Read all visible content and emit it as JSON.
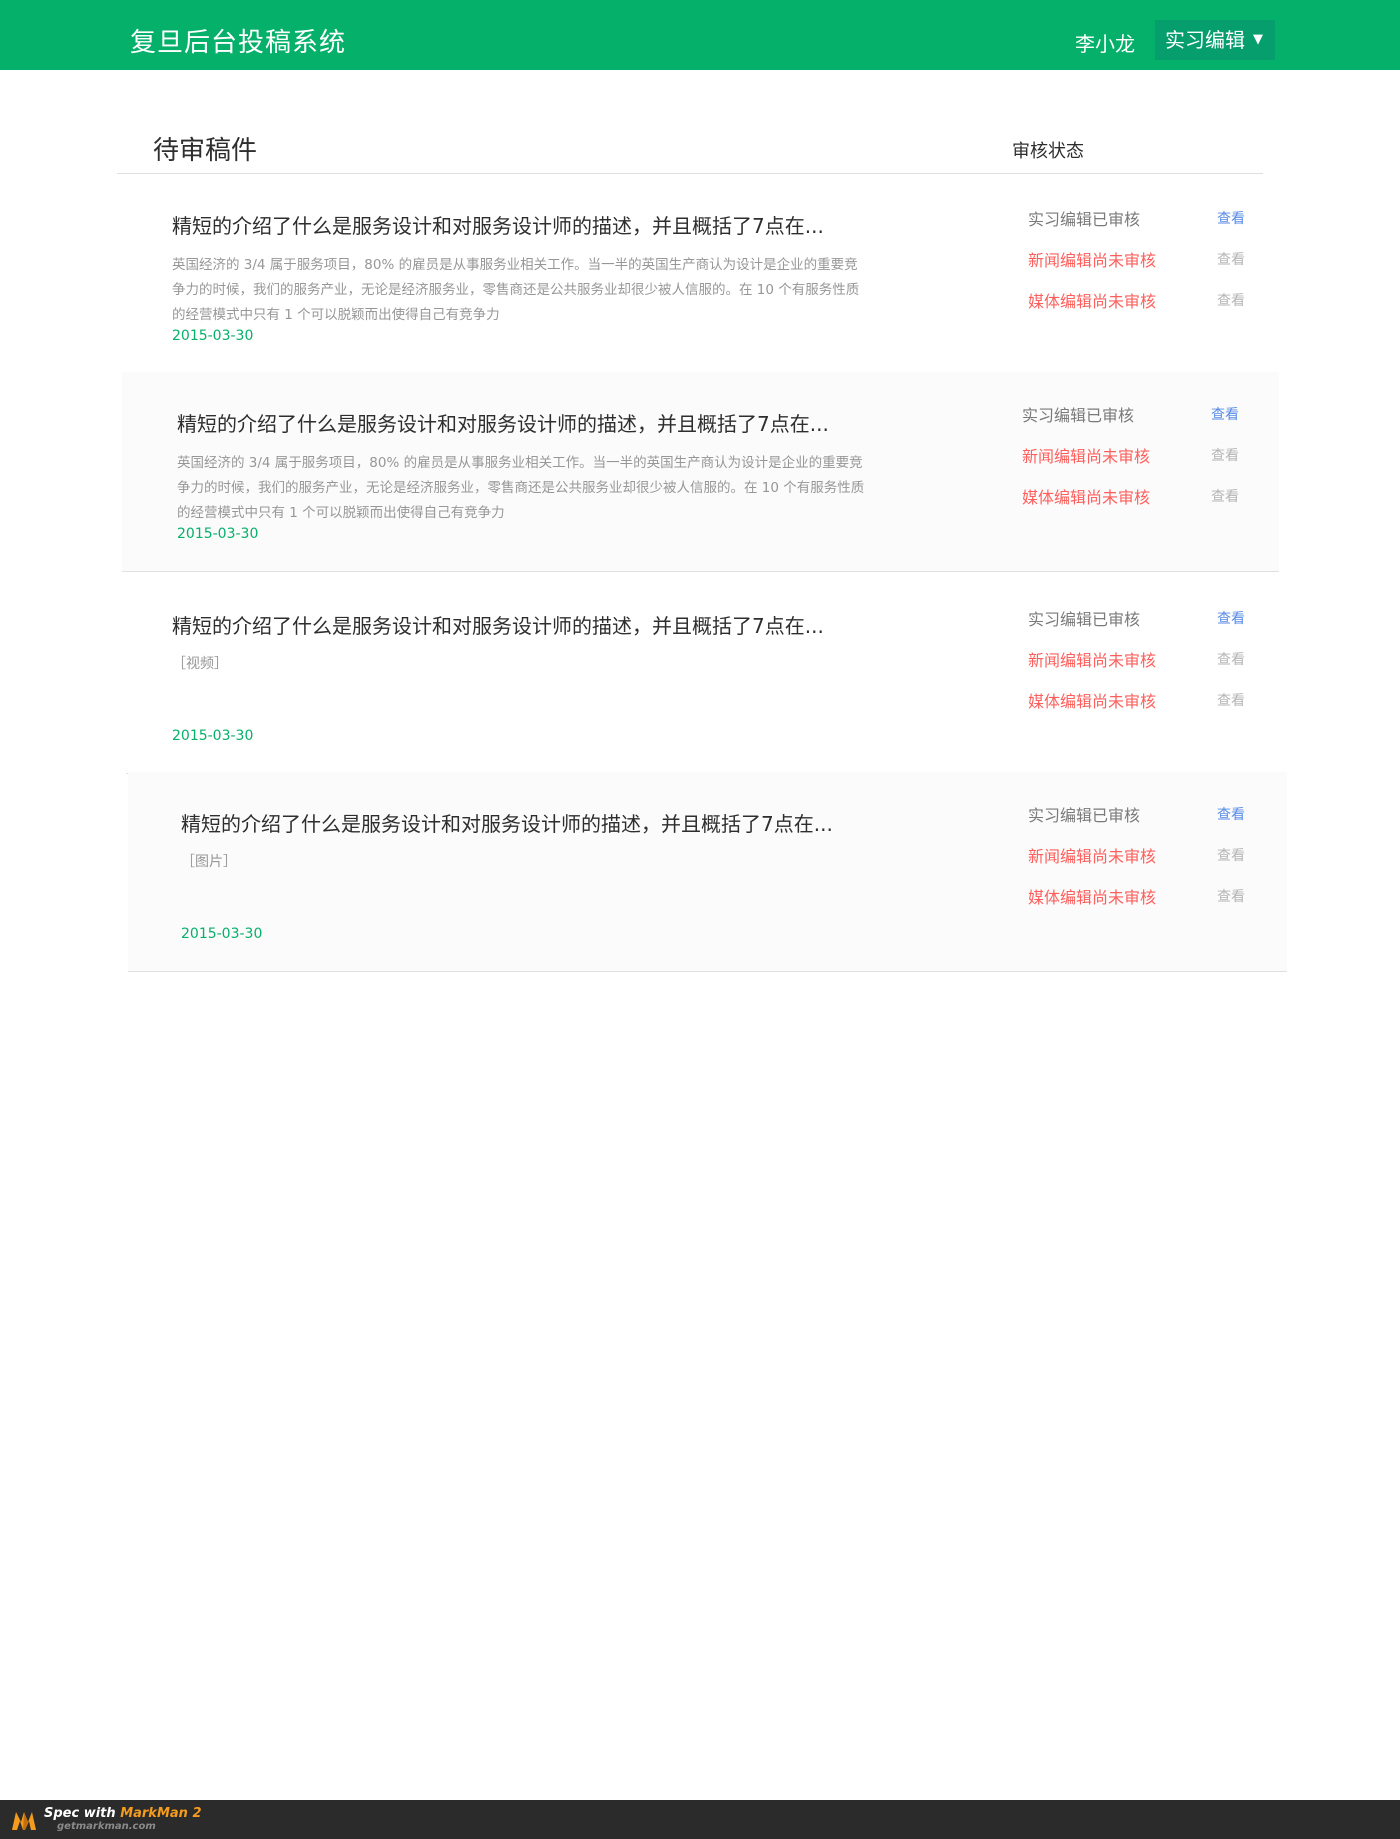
{
  "header": {
    "app_title": "复旦后台投稿系统",
    "user_name": "李小龙",
    "role_label": "实习编辑",
    "role_arrow": "▼"
  },
  "main": {
    "section_title": "待审稿件",
    "status_column_title": "审核状态"
  },
  "articles": [
    {
      "title": "精短的介绍了什么是服务设计和对服务设计师的描述，并且概括了7点在...",
      "description": "英国经济的 3/4 属于服务项目，80% 的雇员是从事服务业相关工作。当一半的英国生产商认为设计是企业的重要竞争力的时候，我们的服务产业，无论是经济服务业，零售商还是公共服务业却很少被人信服的。在 10 个有服务性质的经营模式中只有 1 个可以脱颖而出使得自己有竞争力",
      "date": "2015-03-30",
      "statuses": [
        {
          "label": "实习编辑已审核",
          "state": "reviewed",
          "action": "查看",
          "action_enabled": true
        },
        {
          "label": "新闻编辑尚未审核",
          "state": "pending",
          "action": "查看",
          "action_enabled": false
        },
        {
          "label": "媒体编辑尚未审核",
          "state": "pending",
          "action": "查看",
          "action_enabled": false
        }
      ]
    },
    {
      "title": "精短的介绍了什么是服务设计和对服务设计师的描述，并且概括了7点在...",
      "description": "英国经济的 3/4 属于服务项目，80% 的雇员是从事服务业相关工作。当一半的英国生产商认为设计是企业的重要竞争力的时候，我们的服务产业，无论是经济服务业，零售商还是公共服务业却很少被人信服的。在 10 个有服务性质的经营模式中只有 1 个可以脱颖而出使得自己有竞争力",
      "date": "2015-03-30",
      "statuses": [
        {
          "label": "实习编辑已审核",
          "state": "reviewed",
          "action": "查看",
          "action_enabled": true
        },
        {
          "label": "新闻编辑尚未审核",
          "state": "pending",
          "action": "查看",
          "action_enabled": false
        },
        {
          "label": "媒体编辑尚未审核",
          "state": "pending",
          "action": "查看",
          "action_enabled": false
        }
      ]
    },
    {
      "title": "精短的介绍了什么是服务设计和对服务设计师的描述，并且概括了7点在...",
      "media_tag": "［视频］",
      "date": "2015-03-30",
      "statuses": [
        {
          "label": "实习编辑已审核",
          "state": "reviewed",
          "action": "查看",
          "action_enabled": true
        },
        {
          "label": "新闻编辑尚未审核",
          "state": "pending",
          "action": "查看",
          "action_enabled": false
        },
        {
          "label": "媒体编辑尚未审核",
          "state": "pending",
          "action": "查看",
          "action_enabled": false
        }
      ]
    },
    {
      "title": "精短的介绍了什么是服务设计和对服务设计师的描述，并且概括了7点在...",
      "media_tag": "［图片］",
      "date": "2015-03-30",
      "statuses": [
        {
          "label": "实习编辑已审核",
          "state": "reviewed",
          "action": "查看",
          "action_enabled": true
        },
        {
          "label": "新闻编辑尚未审核",
          "state": "pending",
          "action": "查看",
          "action_enabled": false
        },
        {
          "label": "媒体编辑尚未审核",
          "state": "pending",
          "action": "查看",
          "action_enabled": false
        }
      ]
    }
  ],
  "colors": {
    "header_bg": "#05b06a",
    "role_button_bg": "#069e6d",
    "text_dark": "#2e2e2e",
    "divider": "#e0e0e0",
    "card_bg": "#ffffff",
    "card_bg_alt": "#fbfbfb",
    "text_muted": "#979797",
    "link_blue": "#588be7",
    "status_red": "#fe5f5c"
  },
  "footer": {
    "spec_prefix": "Spec with ",
    "spec_brand": "MarkMan 2",
    "url": "getmarkman.com"
  }
}
